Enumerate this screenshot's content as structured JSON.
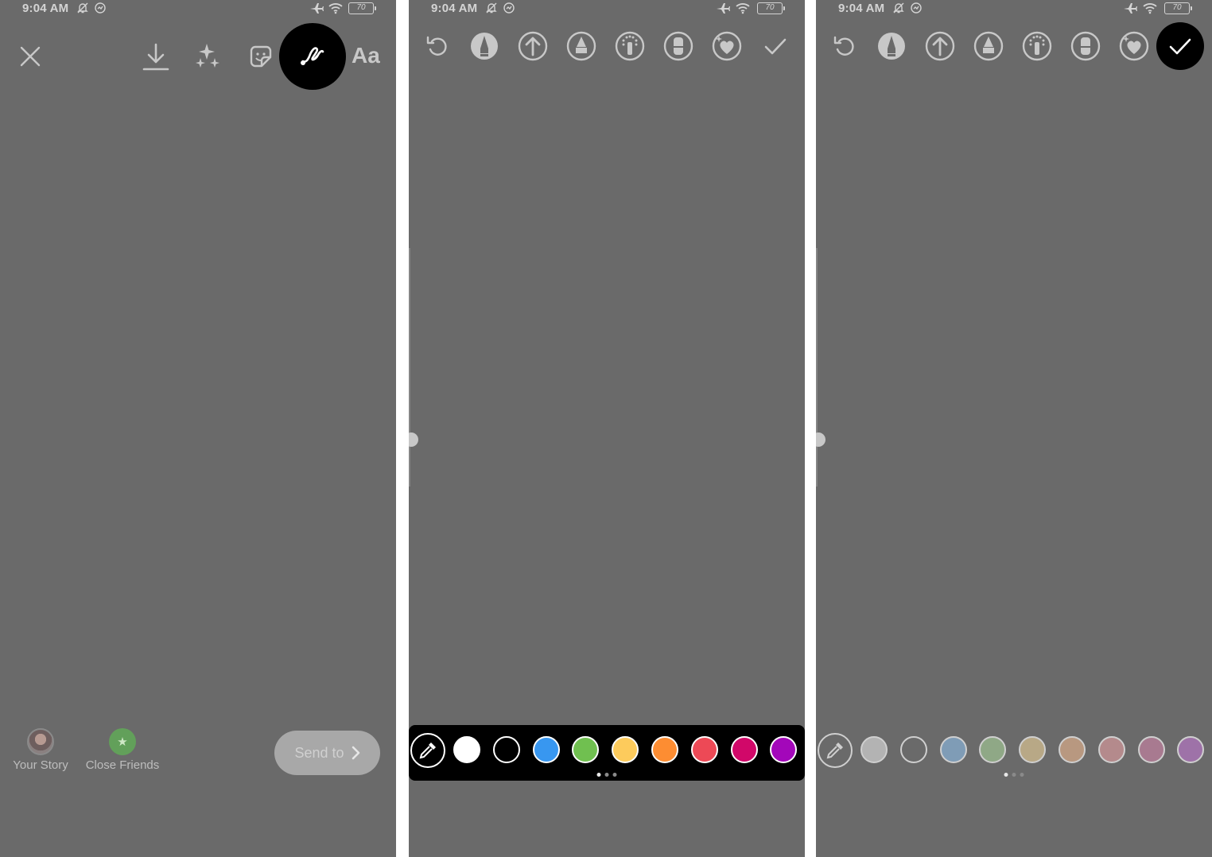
{
  "status": {
    "time": "9:04 AM",
    "battery": "70"
  },
  "panel1": {
    "tools": {
      "text_label": "Aa"
    },
    "targets": [
      {
        "label": "Your Story"
      },
      {
        "label": "Close Friends"
      }
    ],
    "send": {
      "label": "Send to"
    }
  },
  "palette_colors": [
    "#ffffff",
    "#000000",
    "#3897f0",
    "#70c050",
    "#fdcb5c",
    "#fd8d32",
    "#ed4956",
    "#d10869",
    "#a307ba"
  ],
  "palette_colors_dim": [
    "#b3b3b3",
    "#6a6a6a",
    "#7f9cb6",
    "#8fa886",
    "#b8a886",
    "#b89880",
    "#b48a8c",
    "#a87a90",
    "#9e72a8"
  ],
  "colors": {
    "canvas": "#6a6a6a",
    "accent_active": "#000000"
  }
}
